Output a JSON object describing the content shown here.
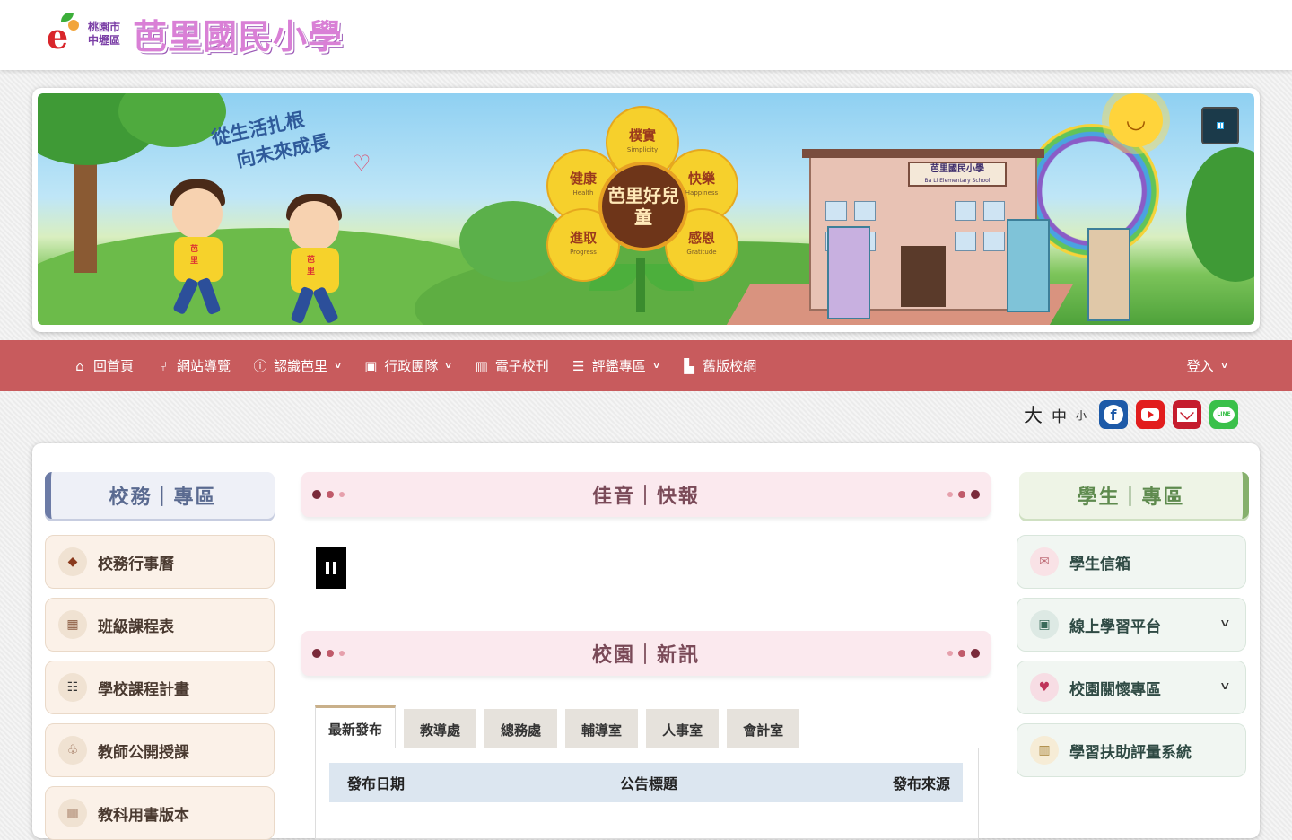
{
  "header": {
    "logo_county": "桃園市中壢區",
    "logo_school": "芭里國民小學"
  },
  "banner": {
    "slogan_line1": "從生活扎根",
    "slogan_line2": "向未來成長",
    "kid_tag": "芭里",
    "flower_center": "芭里好兒童",
    "petals": [
      {
        "zh": "樸實",
        "en": "Simplicity"
      },
      {
        "zh": "健康",
        "en": "Health"
      },
      {
        "zh": "快樂",
        "en": "Happiness"
      },
      {
        "zh": "進取",
        "en": "Progress"
      },
      {
        "zh": "感恩",
        "en": "Gratitude"
      }
    ],
    "building_sign_zh": "芭里國民小學",
    "building_sign_en": "Ba Li Elementary School"
  },
  "nav": {
    "items": [
      {
        "label": "回首頁",
        "icon": "home-icon",
        "dropdown": false
      },
      {
        "label": "網站導覽",
        "icon": "sitemap-icon",
        "dropdown": false
      },
      {
        "label": "認識芭里",
        "icon": "info-icon",
        "dropdown": true
      },
      {
        "label": "行政團隊",
        "icon": "contact-card-icon",
        "dropdown": true
      },
      {
        "label": "電子校刊",
        "icon": "book-icon",
        "dropdown": false
      },
      {
        "label": "評鑑專區",
        "icon": "list-icon",
        "dropdown": true
      },
      {
        "label": "舊版校網",
        "icon": "buildings-icon",
        "dropdown": false
      }
    ],
    "login": "登入"
  },
  "tools": {
    "font_large": "大",
    "font_medium": "中",
    "font_small": "小",
    "line_text": "LINE"
  },
  "left_panel": {
    "title": "校務｜專區",
    "items": [
      {
        "label": "校務行事曆",
        "icon": "diamond-icon"
      },
      {
        "label": "班級課程表",
        "icon": "grid-icon"
      },
      {
        "label": "學校課程計畫",
        "icon": "list-icon"
      },
      {
        "label": "教師公開授課",
        "icon": "clover-icon"
      },
      {
        "label": "教科用書版本",
        "icon": "book-icon"
      }
    ]
  },
  "center": {
    "section1_title": "佳音｜快報",
    "section2_title": "校園｜新訊",
    "tabs": [
      "最新發布",
      "教導處",
      "總務處",
      "輔導室",
      "人事室",
      "會計室"
    ],
    "table_headers": {
      "date": "發布日期",
      "title": "公告標題",
      "source": "發布來源"
    }
  },
  "right_panel": {
    "title": "學生｜專區",
    "items": [
      {
        "label": "學生信箱",
        "icon": "envelope-icon",
        "dropdown": false
      },
      {
        "label": "線上學習平台",
        "icon": "screen-icon",
        "dropdown": true
      },
      {
        "label": "校園關懷專區",
        "icon": "heart-icon",
        "dropdown": true
      },
      {
        "label": "學習扶助評量系統",
        "icon": "columns-icon",
        "dropdown": false
      }
    ]
  },
  "colors": {
    "nav_bg": "#c85b5d",
    "section_head_bg": "#fbe9ee",
    "left_btn_bg": "#fbf1e8",
    "right_btn_bg": "#f1f6f2"
  }
}
